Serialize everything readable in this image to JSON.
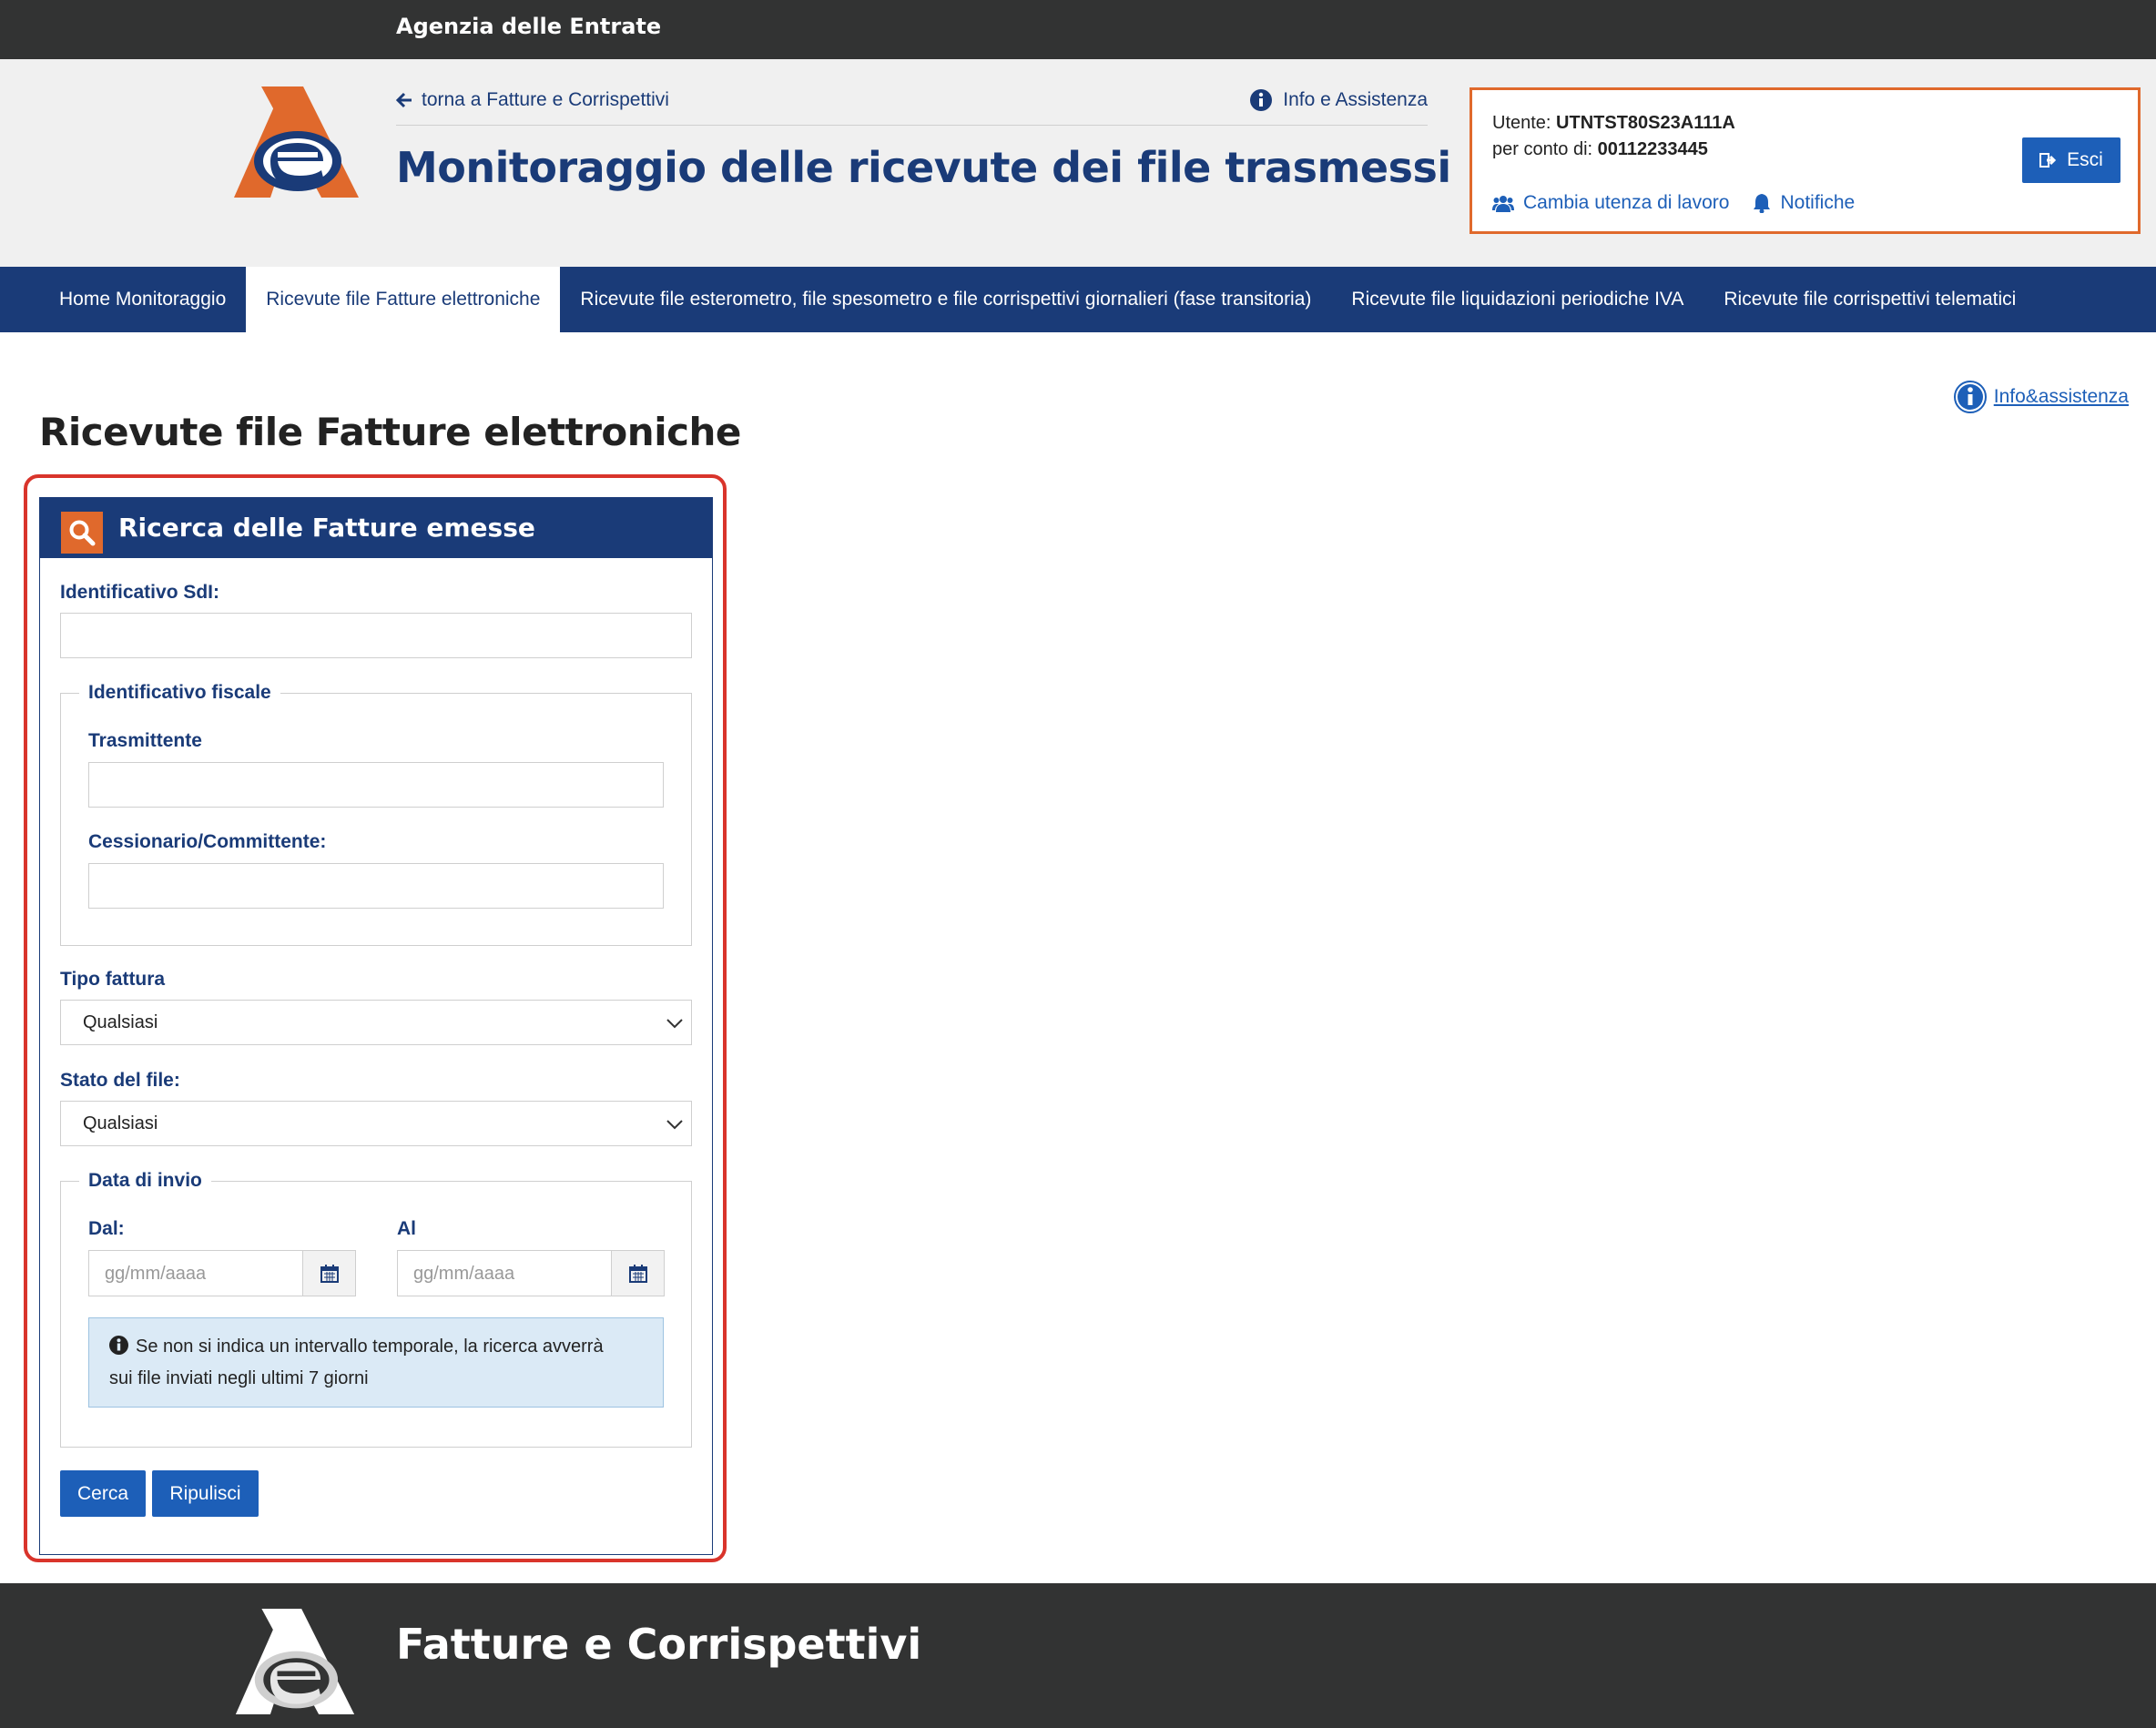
{
  "topbar": {
    "agency": "Agenzia delle Entrate"
  },
  "header": {
    "back_link": "torna a Fatture e Corrispettivi",
    "info_link": "Info e Assistenza",
    "title": "Monitoraggio delle ricevute dei file trasmessi"
  },
  "user": {
    "user_label": "Utente:",
    "user_value": "UTNTST80S23A111A",
    "account_label": "per conto di:",
    "account_value": "00112233445",
    "change_user": "Cambia utenza di lavoro",
    "notifications": "Notifiche",
    "logout": "Esci"
  },
  "nav": {
    "tabs": [
      "Home Monitoraggio",
      "Ricevute file Fatture elettroniche",
      "Ricevute file esterometro, file spesometro e file corrispettivi giornalieri (fase transitoria)",
      "Ricevute file liquidazioni periodiche IVA",
      "Ricevute file corrispettivi telematici"
    ],
    "active_index": 1
  },
  "page": {
    "info_assistance": "Info&assistenza",
    "section_title": "Ricevute file Fatture elettroniche"
  },
  "form": {
    "panel_title": "Ricerca delle Fatture emesse",
    "sdi_label": "Identificativo SdI:",
    "sdi_value": "",
    "fiscal_legend": "Identificativo fiscale",
    "transmitter_label": "Trasmittente",
    "transmitter_value": "",
    "customer_label": "Cessionario/Committente:",
    "customer_value": "",
    "invoice_type_label": "Tipo fattura",
    "invoice_type_value": "Qualsiasi",
    "file_state_label": "Stato del file:",
    "file_state_value": "Qualsiasi",
    "date_legend": "Data di invio",
    "from_label": "Dal:",
    "from_placeholder": "gg/mm/aaaa",
    "to_label": "Al",
    "to_placeholder": "gg/mm/aaaa",
    "notice_line1": "Se non si indica un intervallo temporale, la ricerca avverrà",
    "notice_line2": "sui file inviati negli ultimi 7 giorni",
    "search_button": "Cerca",
    "reset_button": "Ripulisci"
  },
  "footer": {
    "title": "Fatture e Corrispettivi"
  },
  "colors": {
    "brand_blue": "#1a3b78",
    "link_blue": "#1d5fb8",
    "accent_orange": "#e0692c",
    "dark_bar": "#323333",
    "highlight_red": "#d9342b"
  },
  "icons": [
    "agency-logo",
    "arrow-left-icon",
    "info-icon",
    "users-icon",
    "bell-icon",
    "logout-icon",
    "search-icon",
    "chevron-down-icon",
    "calendar-icon"
  ]
}
